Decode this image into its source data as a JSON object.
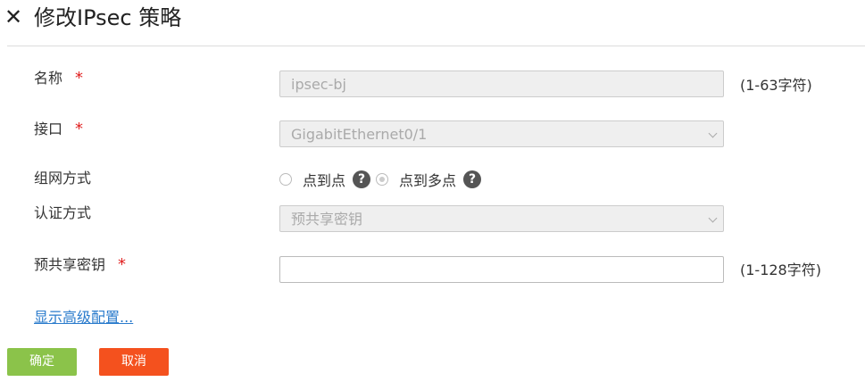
{
  "header": {
    "title": "修改IPsec 策略",
    "close_symbol": "✕"
  },
  "form": {
    "name": {
      "label": "名称",
      "required_mark": "*",
      "value": "ipsec-bj",
      "hint": "(1-63字符)"
    },
    "interface": {
      "label": "接口",
      "required_mark": "*",
      "value": "GigabitEthernet0/1"
    },
    "network_mode": {
      "label": "组网方式",
      "options": [
        {
          "label": "点到点",
          "checked": false
        },
        {
          "label": "点到多点",
          "checked": true
        }
      ],
      "help_symbol": "?"
    },
    "auth_method": {
      "label": "认证方式",
      "value": "预共享密钥"
    },
    "psk": {
      "label": "预共享密钥",
      "required_mark": "*",
      "value": "",
      "hint": "(1-128字符)"
    },
    "advanced_link": "显示高级配置..."
  },
  "buttons": {
    "ok": "确定",
    "cancel": "取消"
  },
  "colors": {
    "ok": "#8bc34a",
    "cancel": "#f4511e",
    "link": "#2a7bcc",
    "required": "#e02020"
  }
}
